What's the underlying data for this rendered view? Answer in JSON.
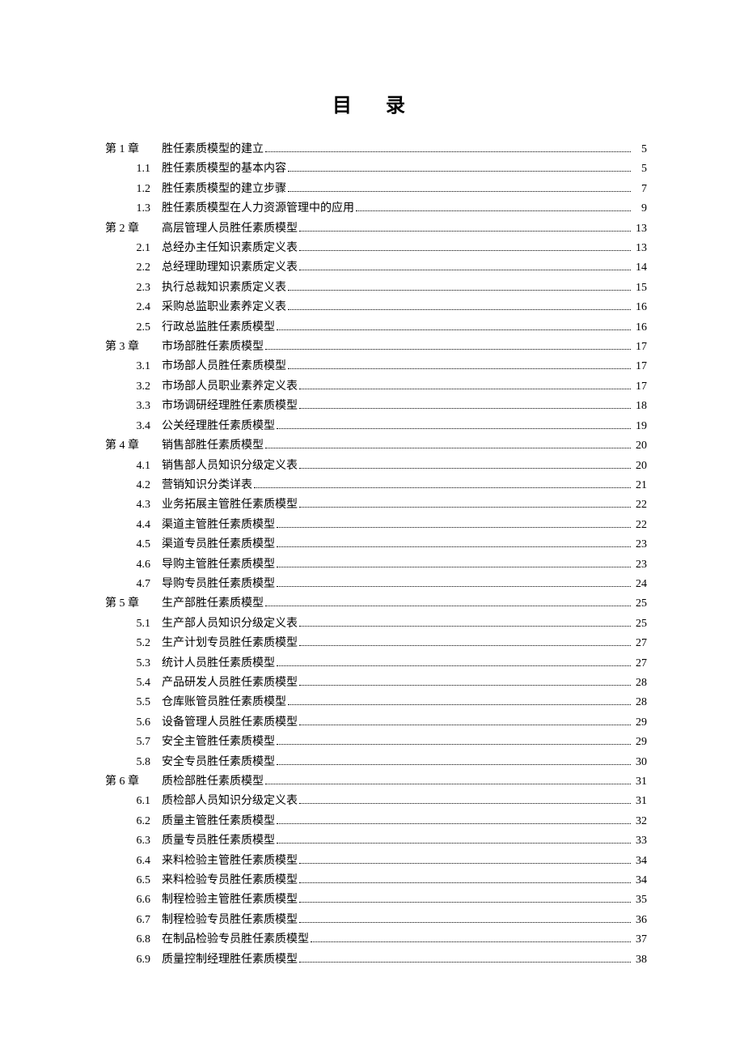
{
  "title": "目 录",
  "toc": [
    {
      "level": "chapter",
      "num": "第 1 章",
      "text": "胜任素质模型的建立",
      "page": "5"
    },
    {
      "level": "section",
      "num": "1.1",
      "text": "胜任素质模型的基本内容",
      "page": "5"
    },
    {
      "level": "section",
      "num": "1.2",
      "text": "胜任素质模型的建立步骤",
      "page": "7"
    },
    {
      "level": "section",
      "num": "1.3",
      "text": "胜任素质模型在人力资源管理中的应用",
      "page": "9"
    },
    {
      "level": "chapter",
      "num": "第 2 章",
      "text": "高层管理人员胜任素质模型",
      "page": "13"
    },
    {
      "level": "section",
      "num": "2.1",
      "text": "总经办主任知识素质定义表",
      "page": "13"
    },
    {
      "level": "section",
      "num": "2.2",
      "text": "总经理助理知识素质定义表",
      "page": "14"
    },
    {
      "level": "section",
      "num": "2.3",
      "text": "执行总裁知识素质定义表",
      "page": "15"
    },
    {
      "level": "section",
      "num": "2.4",
      "text": "采购总监职业素养定义表",
      "page": "16"
    },
    {
      "level": "section",
      "num": "2.5",
      "text": "行政总监胜任素质模型",
      "page": "16"
    },
    {
      "level": "chapter",
      "num": "第 3 章",
      "text": "市场部胜任素质模型",
      "page": "17"
    },
    {
      "level": "section",
      "num": "3.1",
      "text": "市场部人员胜任素质模型",
      "page": "17"
    },
    {
      "level": "section",
      "num": "3.2",
      "text": "市场部人员职业素养定义表",
      "page": "17"
    },
    {
      "level": "section",
      "num": "3.3",
      "text": "市场调研经理胜任素质模型",
      "page": "18"
    },
    {
      "level": "section",
      "num": "3.4",
      "text": "公关经理胜任素质模型",
      "page": "19"
    },
    {
      "level": "chapter",
      "num": "第 4 章",
      "text": "销售部胜任素质模型",
      "page": "20"
    },
    {
      "level": "section",
      "num": "4.1",
      "text": "销售部人员知识分级定义表",
      "page": "20"
    },
    {
      "level": "section",
      "num": "4.2",
      "text": "营销知识分类详表",
      "page": "21"
    },
    {
      "level": "section",
      "num": "4.3",
      "text": "业务拓展主管胜任素质模型",
      "page": "22"
    },
    {
      "level": "section",
      "num": "4.4",
      "text": "渠道主管胜任素质模型",
      "page": "22"
    },
    {
      "level": "section",
      "num": "4.5",
      "text": "渠道专员胜任素质模型",
      "page": "23"
    },
    {
      "level": "section",
      "num": "4.6",
      "text": "导购主管胜任素质模型",
      "page": "23"
    },
    {
      "level": "section",
      "num": "4.7",
      "text": "导购专员胜任素质模型",
      "page": "24"
    },
    {
      "level": "chapter",
      "num": "第 5 章",
      "text": "生产部胜任素质模型",
      "page": "25"
    },
    {
      "level": "section",
      "num": "5.1",
      "text": "生产部人员知识分级定义表",
      "page": "25"
    },
    {
      "level": "section",
      "num": "5.2",
      "text": "生产计划专员胜任素质模型",
      "page": "27"
    },
    {
      "level": "section",
      "num": "5.3",
      "text": "统计人员胜任素质模型",
      "page": "27"
    },
    {
      "level": "section",
      "num": "5.4",
      "text": "产品研发人员胜任素质模型",
      "page": "28"
    },
    {
      "level": "section",
      "num": "5.5",
      "text": "仓库账管员胜任素质模型",
      "page": "28"
    },
    {
      "level": "section",
      "num": "5.6",
      "text": "设备管理人员胜任素质模型",
      "page": "29"
    },
    {
      "level": "section",
      "num": "5.7",
      "text": "安全主管胜任素质模型",
      "page": "29"
    },
    {
      "level": "section",
      "num": "5.8",
      "text": "安全专员胜任素质模型",
      "page": "30"
    },
    {
      "level": "chapter",
      "num": "第 6 章",
      "text": "质检部胜任素质模型",
      "page": "31"
    },
    {
      "level": "section",
      "num": "6.1",
      "text": "质检部人员知识分级定义表",
      "page": "31"
    },
    {
      "level": "section",
      "num": "6.2",
      "text": "质量主管胜任素质模型",
      "page": "32"
    },
    {
      "level": "section",
      "num": "6.3",
      "text": "质量专员胜任素质模型",
      "page": "33"
    },
    {
      "level": "section",
      "num": "6.4",
      "text": "来料检验主管胜任素质模型",
      "page": "34"
    },
    {
      "level": "section",
      "num": "6.5",
      "text": "来料检验专员胜任素质模型",
      "page": "34"
    },
    {
      "level": "section",
      "num": "6.6",
      "text": "制程检验主管胜任素质模型",
      "page": "35"
    },
    {
      "level": "section",
      "num": "6.7",
      "text": "制程检验专员胜任素质模型",
      "page": "36"
    },
    {
      "level": "section",
      "num": "6.8",
      "text": "在制品检验专员胜任素质模型",
      "page": "37"
    },
    {
      "level": "section",
      "num": "6.9",
      "text": "质量控制经理胜任素质模型",
      "page": "38"
    }
  ]
}
